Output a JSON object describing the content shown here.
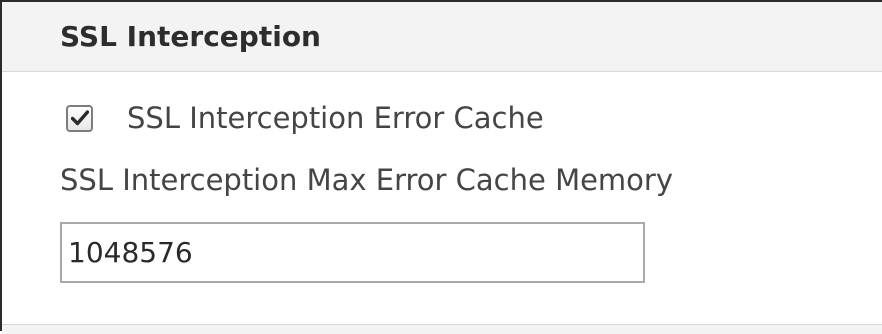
{
  "section": {
    "title": "SSL Interception"
  },
  "error_cache": {
    "checkbox_label": "SSL Interception Error Cache",
    "checked": true
  },
  "max_memory": {
    "label": "SSL Interception Max Error Cache Memory",
    "value": "1048576"
  },
  "colors": {
    "header_bg": "#f3f3f3",
    "text": "#454545",
    "title_text": "#2d2d2d",
    "checkmark": "#2b2b2b"
  }
}
